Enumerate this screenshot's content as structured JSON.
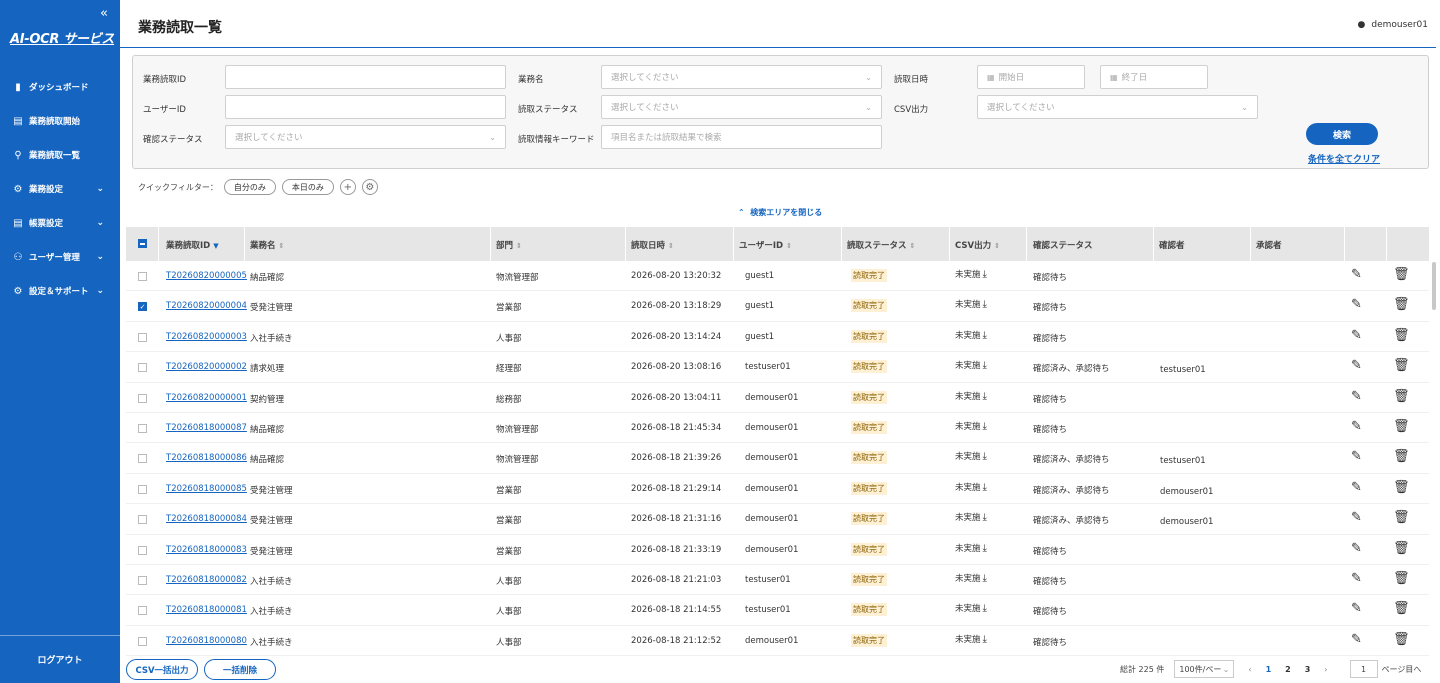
{
  "sidebar": {
    "logo": "AI-OCR サービス",
    "items": [
      {
        "label": "ダッシュボード",
        "icon": "bar-chart-icon",
        "glyph": "▮",
        "chevron": false
      },
      {
        "label": "業務読取開始",
        "icon": "document-icon",
        "glyph": "▤",
        "chevron": false
      },
      {
        "label": "業務読取一覧",
        "icon": "search-icon",
        "glyph": "⚲",
        "chevron": false
      },
      {
        "label": "業務設定",
        "icon": "gear-icon",
        "glyph": "⚙",
        "chevron": true
      },
      {
        "label": "帳票設定",
        "icon": "form-icon",
        "glyph": "▤",
        "chevron": true
      },
      {
        "label": "ユーザー管理",
        "icon": "user-icon",
        "glyph": "⚇",
        "chevron": true
      },
      {
        "label": "設定＆サポート",
        "icon": "settings-icon",
        "glyph": "⚙",
        "chevron": true
      }
    ],
    "logout": "ログアウト"
  },
  "header": {
    "title": "業務読取一覧",
    "user": "demouser01"
  },
  "search": {
    "labels": {
      "read_id": "業務読取ID",
      "task_name": "業務名",
      "read_datetime": "読取日時",
      "user_id": "ユーザーID",
      "read_status": "読取ステータス",
      "csv_output": "CSV出力",
      "confirm_status": "確認ステータス",
      "keyword": "読取情報キーワード"
    },
    "placeholders": {
      "select": "選択してください",
      "start_date": "開始日",
      "end_date": "終了日",
      "keyword": "項目名または読取結果で検索"
    },
    "search_button": "検索",
    "clear_link": "条件を全てクリア"
  },
  "quick_filter": {
    "label": "クイックフィルター：",
    "chips": [
      "自分のみ",
      "本日のみ"
    ]
  },
  "close_search_area": "検索エリアを閉じる",
  "table": {
    "columns": [
      "業務読取ID",
      "業務名",
      "部門",
      "読取日時",
      "ユーザーID",
      "読取ステータス",
      "CSV出力",
      "確認ステータス",
      "確認者",
      "承認者"
    ],
    "rows": [
      {
        "id": "T20260820000005",
        "task": "納品確認",
        "dept": "物流管理部",
        "datetime": "2026-08-20 13:20:32",
        "user": "guest1",
        "status": "読取完了",
        "csv": "未実施",
        "confirm": "確認待ち",
        "confirmer": "",
        "checked": false
      },
      {
        "id": "T20260820000004",
        "task": "受発注管理",
        "dept": "営業部",
        "datetime": "2026-08-20 13:18:29",
        "user": "guest1",
        "status": "読取完了",
        "csv": "未実施",
        "confirm": "確認待ち",
        "confirmer": "",
        "checked": true
      },
      {
        "id": "T20260820000003",
        "task": "入社手続き",
        "dept": "人事部",
        "datetime": "2026-08-20 13:14:24",
        "user": "guest1",
        "status": "読取完了",
        "csv": "未実施",
        "confirm": "確認待ち",
        "confirmer": "",
        "checked": false
      },
      {
        "id": "T20260820000002",
        "task": "請求処理",
        "dept": "経理部",
        "datetime": "2026-08-20 13:08:16",
        "user": "testuser01",
        "status": "読取完了",
        "csv": "未実施",
        "confirm": "確認済み、承認待ち",
        "confirmer": "testuser01",
        "checked": false
      },
      {
        "id": "T20260820000001",
        "task": "契約管理",
        "dept": "総務部",
        "datetime": "2026-08-20 13:04:11",
        "user": "demouser01",
        "status": "読取完了",
        "csv": "未実施",
        "confirm": "確認待ち",
        "confirmer": "",
        "checked": false
      },
      {
        "id": "T20260818000087",
        "task": "納品確認",
        "dept": "物流管理部",
        "datetime": "2026-08-18 21:45:34",
        "user": "demouser01",
        "status": "読取完了",
        "csv": "未実施",
        "confirm": "確認待ち",
        "confirmer": "",
        "checked": false
      },
      {
        "id": "T20260818000086",
        "task": "納品確認",
        "dept": "物流管理部",
        "datetime": "2026-08-18 21:39:26",
        "user": "demouser01",
        "status": "読取完了",
        "csv": "未実施",
        "confirm": "確認済み、承認待ち",
        "confirmer": "testuser01",
        "checked": false
      },
      {
        "id": "T20260818000085",
        "task": "受発注管理",
        "dept": "営業部",
        "datetime": "2026-08-18 21:29:14",
        "user": "demouser01",
        "status": "読取完了",
        "csv": "未実施",
        "confirm": "確認済み、承認待ち",
        "confirmer": "demouser01",
        "checked": false
      },
      {
        "id": "T20260818000084",
        "task": "受発注管理",
        "dept": "営業部",
        "datetime": "2026-08-18 21:31:16",
        "user": "demouser01",
        "status": "読取完了",
        "csv": "未実施",
        "confirm": "確認済み、承認待ち",
        "confirmer": "demouser01",
        "checked": false
      },
      {
        "id": "T20260818000083",
        "task": "受発注管理",
        "dept": "営業部",
        "datetime": "2026-08-18 21:33:19",
        "user": "demouser01",
        "status": "読取完了",
        "csv": "未実施",
        "confirm": "確認待ち",
        "confirmer": "",
        "checked": false
      },
      {
        "id": "T20260818000082",
        "task": "入社手続き",
        "dept": "人事部",
        "datetime": "2026-08-18 21:21:03",
        "user": "testuser01",
        "status": "読取完了",
        "csv": "未実施",
        "confirm": "確認待ち",
        "confirmer": "",
        "checked": false
      },
      {
        "id": "T20260818000081",
        "task": "入社手続き",
        "dept": "人事部",
        "datetime": "2026-08-18 21:14:55",
        "user": "testuser01",
        "status": "読取完了",
        "csv": "未実施",
        "confirm": "確認待ち",
        "confirmer": "",
        "checked": false
      },
      {
        "id": "T20260818000080",
        "task": "入社手続き",
        "dept": "人事部",
        "datetime": "2026-08-18 21:12:52",
        "user": "demouser01",
        "status": "読取完了",
        "csv": "未実施",
        "confirm": "確認待ち",
        "confirmer": "",
        "checked": false
      }
    ]
  },
  "footer": {
    "csv_bulk": "CSV一括出力",
    "bulk_delete": "一括削除",
    "total": "総計 225 件",
    "per_page": "100件/ペー",
    "pages": [
      "1",
      "2",
      "3"
    ],
    "current_page_input": "1",
    "page_suffix": "ページ目へ"
  },
  "colors": {
    "primary": "#1565c0",
    "badge_bg": "#fdf0d5"
  }
}
